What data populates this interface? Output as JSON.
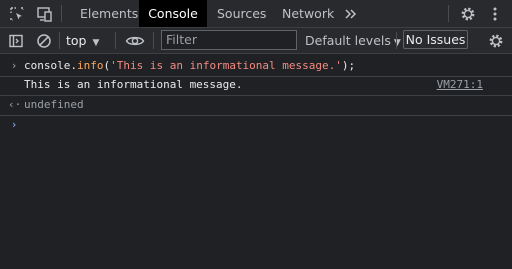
{
  "tabs": {
    "elements": "Elements",
    "console": "Console",
    "sources": "Sources",
    "network": "Network"
  },
  "toolbar": {
    "context": "top",
    "filter_placeholder": "Filter",
    "levels": "Default levels",
    "issues": "No Issues"
  },
  "console": {
    "input": {
      "obj": "console",
      "dot": ".",
      "method": "info",
      "open": "(",
      "arg": "'This is an informational message.'",
      "close": ");"
    },
    "message": "This is an informational message.",
    "source": "VM271:1",
    "result": "undefined"
  },
  "colors": {
    "background": "#202124",
    "toolbar": "#292a2d",
    "active_tab": "#000000",
    "accent_prompt": "#8ab4f8"
  },
  "icons": [
    "inspect-icon",
    "device-toggle-icon",
    "more-tabs-icon",
    "settings-icon",
    "more-options-icon",
    "sidebar-toggle-icon",
    "clear-console-icon",
    "eye-icon",
    "console-settings-icon"
  ]
}
